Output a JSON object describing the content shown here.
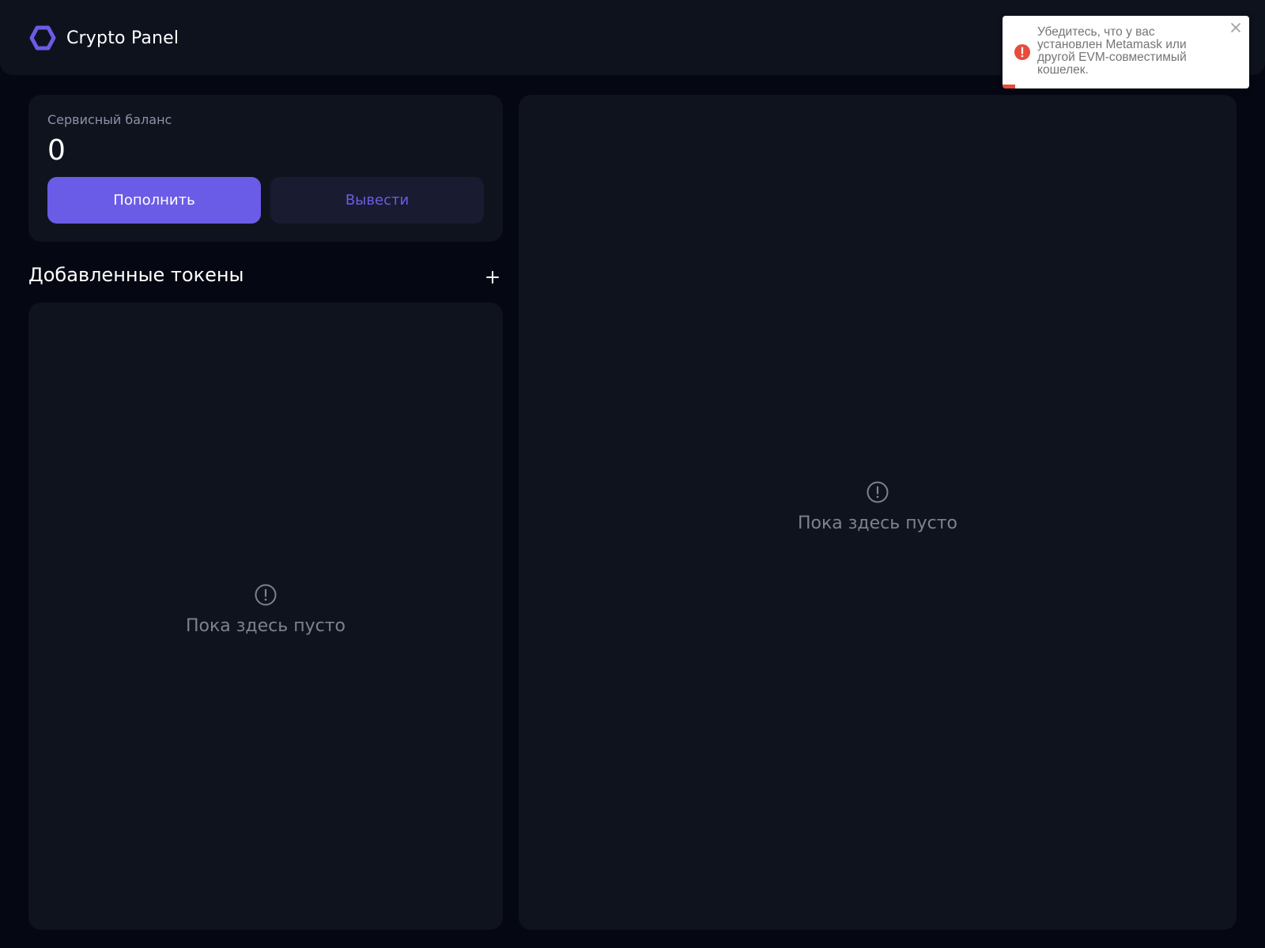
{
  "app": {
    "title": "Crypto Panel",
    "logo_icon": "hexagon-logo-icon"
  },
  "balance": {
    "label": "Сервисный баланс",
    "value": "0",
    "deposit_label": "Пополнить",
    "withdraw_label": "Вывести"
  },
  "tokens": {
    "title": "Добавленные токены",
    "add_icon": "plus-icon",
    "empty_icon": "alert-circle-icon",
    "empty_text": "Пока здесь пусто"
  },
  "main_panel": {
    "empty_icon": "alert-circle-icon",
    "empty_text": "Пока здесь пусто"
  },
  "toast": {
    "type": "error",
    "icon": "error-icon",
    "message": "Убедитесь, что у вас установлен Metamask или другой EVM-совместимый кошелек.",
    "close_icon": "close-icon",
    "progress": 0.05
  },
  "colors": {
    "accent": "#6b5ce7",
    "background": "#050812",
    "card": "#0f131e",
    "error": "#e74c3c"
  }
}
